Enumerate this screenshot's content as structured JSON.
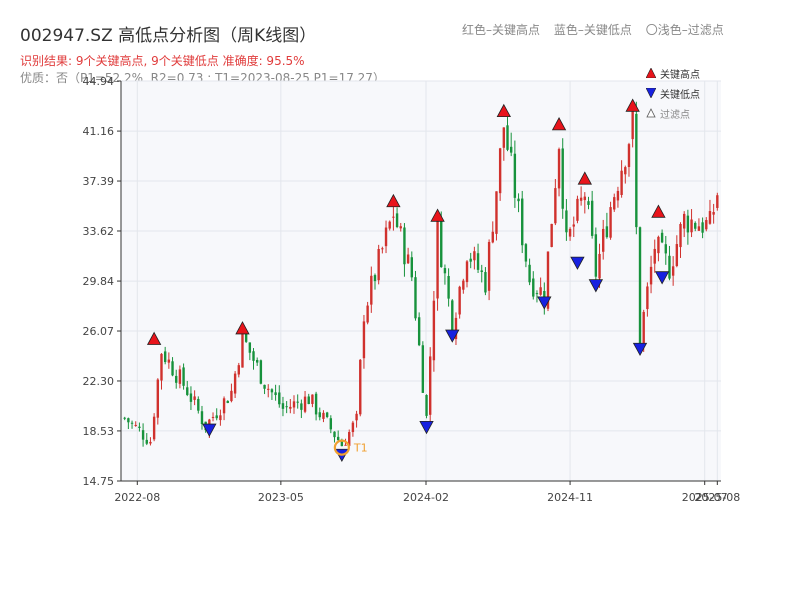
{
  "header": {
    "title": "002947.SZ 高低点分析图（周K线图）",
    "legend_red": "红色–关键高点",
    "legend_blue": "蓝色–关键低点",
    "legend_light": "〇浅色–过滤点",
    "result_text": "识别结果: 9个关键高点, 9个关键低点  准确度: 95.5%",
    "quality_text": "优质：否（P1=52.2%, R2=0.73 ; T1=2023-08-25 P1=17.27）"
  },
  "legend": {
    "high": "关键高点",
    "low": "关键低点",
    "filtered": "过滤点"
  },
  "colors": {
    "up": "#d0312d",
    "down": "#17923c",
    "high_marker": "#e8141b",
    "low_marker": "#1721e0",
    "t1_marker": "#f0a030",
    "grid": "#e3e6ec",
    "plot_bg": "#f7f8fb"
  },
  "chart_data": {
    "type": "candlestick",
    "ylim": [
      14.75,
      44.94
    ],
    "yticks": [
      14.75,
      18.53,
      22.3,
      26.07,
      29.84,
      33.62,
      37.39,
      41.16,
      44.94
    ],
    "xlim": [
      "2022-07-01",
      "2025-08-15"
    ],
    "xticks": [
      {
        "date": "2022-08-01",
        "label": "2022-08"
      },
      {
        "date": "2023-05-01",
        "label": "2023-05"
      },
      {
        "date": "2024-02-01",
        "label": "2024-02"
      },
      {
        "date": "2024-11-01",
        "label": "2024-11"
      },
      {
        "date": "2025-07-15",
        "label": "2025-07"
      },
      {
        "date": "2025-08-08",
        "label": "2025-08"
      }
    ],
    "anchors": [
      {
        "date": "2022-07-08",
        "close": 19.5
      },
      {
        "date": "2022-08-26",
        "close": 17.8
      },
      {
        "date": "2022-09-16",
        "close": 24.6
      },
      {
        "date": "2022-11-04",
        "close": 21.6
      },
      {
        "date": "2022-12-09",
        "close": 18.9
      },
      {
        "date": "2023-01-27",
        "close": 21.5
      },
      {
        "date": "2023-02-17",
        "close": 25.6
      },
      {
        "date": "2023-03-31",
        "close": 22.2
      },
      {
        "date": "2023-05-05",
        "close": 20.2
      },
      {
        "date": "2023-06-23",
        "close": 21.0
      },
      {
        "date": "2023-08-25",
        "close": 17.5
      },
      {
        "date": "2023-09-22",
        "close": 19.3
      },
      {
        "date": "2023-10-06",
        "close": 27.5
      },
      {
        "date": "2023-12-01",
        "close": 35.0
      },
      {
        "date": "2024-01-05",
        "close": 30.2
      },
      {
        "date": "2024-02-02",
        "close": 19.5
      },
      {
        "date": "2024-02-23",
        "close": 33.8
      },
      {
        "date": "2024-03-22",
        "close": 26.5
      },
      {
        "date": "2024-04-19",
        "close": 32.2
      },
      {
        "date": "2024-05-24",
        "close": 29.8
      },
      {
        "date": "2024-06-28",
        "close": 41.6
      },
      {
        "date": "2024-08-16",
        "close": 30.0
      },
      {
        "date": "2024-09-13",
        "close": 28.8
      },
      {
        "date": "2024-10-11",
        "close": 40.5
      },
      {
        "date": "2024-10-25",
        "close": 32.5
      },
      {
        "date": "2024-11-29",
        "close": 36.5
      },
      {
        "date": "2024-12-20",
        "close": 30.5
      },
      {
        "date": "2025-01-17",
        "close": 35.5
      },
      {
        "date": "2025-02-28",
        "close": 41.7
      },
      {
        "date": "2025-03-14",
        "close": 25.5
      },
      {
        "date": "2025-04-11",
        "close": 32.5
      },
      {
        "date": "2025-05-09",
        "close": 30.9
      },
      {
        "date": "2025-06-06",
        "close": 34.5
      },
      {
        "date": "2025-07-25",
        "close": 34.0
      },
      {
        "date": "2025-08-08",
        "close": 36.5
      }
    ],
    "key_highs": [
      {
        "date": "2022-09-02",
        "value": 24.9
      },
      {
        "date": "2023-02-17",
        "value": 25.7
      },
      {
        "date": "2023-12-01",
        "value": 35.3
      },
      {
        "date": "2024-02-23",
        "value": 34.2
      },
      {
        "date": "2024-06-28",
        "value": 42.1
      },
      {
        "date": "2024-10-11",
        "value": 41.1
      },
      {
        "date": "2024-11-29",
        "value": 37.0
      },
      {
        "date": "2025-02-28",
        "value": 42.5
      },
      {
        "date": "2025-04-18",
        "value": 34.5
      }
    ],
    "key_lows": [
      {
        "date": "2022-12-16",
        "value": 19.2
      },
      {
        "date": "2023-08-25",
        "value": 17.3
      },
      {
        "date": "2024-02-02",
        "value": 19.4
      },
      {
        "date": "2024-03-22",
        "value": 26.3
      },
      {
        "date": "2024-09-13",
        "value": 28.8
      },
      {
        "date": "2024-11-15",
        "value": 31.8
      },
      {
        "date": "2024-12-20",
        "value": 30.1
      },
      {
        "date": "2025-03-14",
        "value": 25.3
      },
      {
        "date": "2025-04-25",
        "value": 30.7
      }
    ],
    "t1": {
      "date": "2023-08-25",
      "value": 17.27,
      "label": "T1"
    }
  }
}
